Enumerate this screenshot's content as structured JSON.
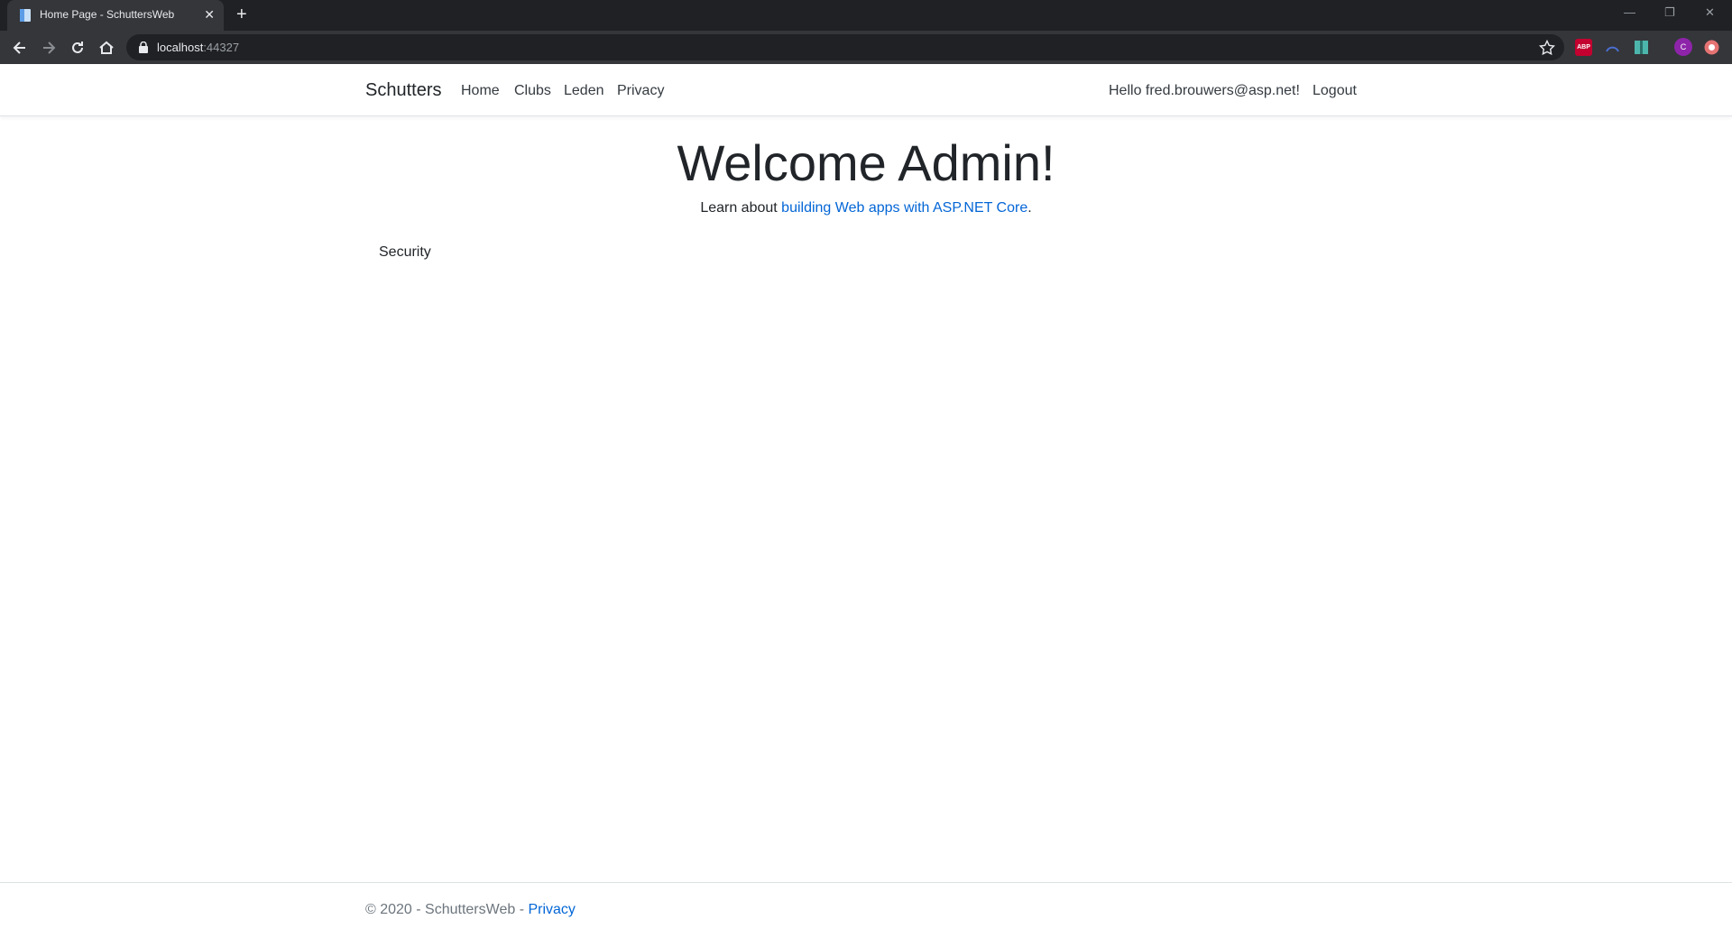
{
  "browser": {
    "tab_title": "Home Page - SchuttersWeb",
    "tab_close": "✕",
    "new_tab": "+",
    "url_host": "localhost",
    "url_port": ":44327",
    "window_minimize": "—",
    "window_restore": "❐",
    "window_close": "✕",
    "extensions": [
      {
        "name": "adblock-extension",
        "label": "ABP",
        "color": "#c3002f"
      },
      {
        "name": "profile-avatar",
        "label": "C",
        "color": "#8e24aa"
      }
    ]
  },
  "navbar": {
    "brand": "Schutters",
    "links": [
      "Home",
      "Clubs",
      "Leden",
      "Privacy"
    ],
    "greeting": "Hello fred.brouwers@asp.net!",
    "logout": "Logout"
  },
  "main": {
    "title": "Welcome Admin!",
    "learn_prefix": "Learn about ",
    "learn_link": "building Web apps with ASP.NET Core",
    "learn_suffix": ".",
    "security_label": "Security"
  },
  "footer": {
    "copyright": "© 2020 - SchuttersWeb - ",
    "privacy_link": "Privacy"
  },
  "colors": {
    "link": "#0366d6",
    "chrome_dark": "#202124",
    "chrome_tab": "#35363a"
  }
}
